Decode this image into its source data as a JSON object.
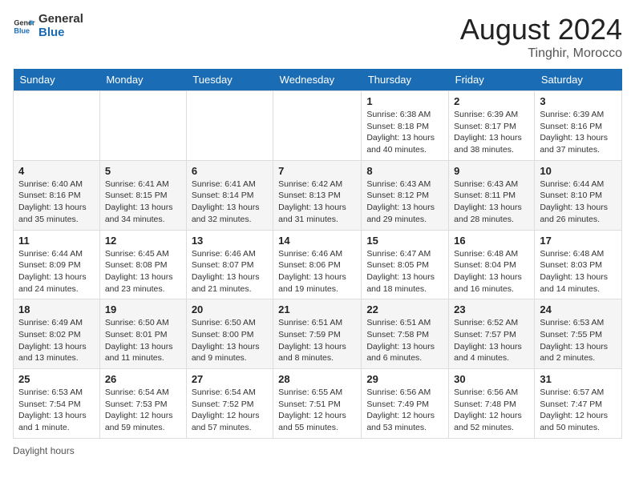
{
  "header": {
    "logo_general": "General",
    "logo_blue": "Blue",
    "month_year": "August 2024",
    "location": "Tinghir, Morocco"
  },
  "days_of_week": [
    "Sunday",
    "Monday",
    "Tuesday",
    "Wednesday",
    "Thursday",
    "Friday",
    "Saturday"
  ],
  "weeks": [
    [
      {
        "day": "",
        "info": ""
      },
      {
        "day": "",
        "info": ""
      },
      {
        "day": "",
        "info": ""
      },
      {
        "day": "",
        "info": ""
      },
      {
        "day": "1",
        "info": "Sunrise: 6:38 AM\nSunset: 8:18 PM\nDaylight: 13 hours and 40 minutes."
      },
      {
        "day": "2",
        "info": "Sunrise: 6:39 AM\nSunset: 8:17 PM\nDaylight: 13 hours and 38 minutes."
      },
      {
        "day": "3",
        "info": "Sunrise: 6:39 AM\nSunset: 8:16 PM\nDaylight: 13 hours and 37 minutes."
      }
    ],
    [
      {
        "day": "4",
        "info": "Sunrise: 6:40 AM\nSunset: 8:16 PM\nDaylight: 13 hours and 35 minutes."
      },
      {
        "day": "5",
        "info": "Sunrise: 6:41 AM\nSunset: 8:15 PM\nDaylight: 13 hours and 34 minutes."
      },
      {
        "day": "6",
        "info": "Sunrise: 6:41 AM\nSunset: 8:14 PM\nDaylight: 13 hours and 32 minutes."
      },
      {
        "day": "7",
        "info": "Sunrise: 6:42 AM\nSunset: 8:13 PM\nDaylight: 13 hours and 31 minutes."
      },
      {
        "day": "8",
        "info": "Sunrise: 6:43 AM\nSunset: 8:12 PM\nDaylight: 13 hours and 29 minutes."
      },
      {
        "day": "9",
        "info": "Sunrise: 6:43 AM\nSunset: 8:11 PM\nDaylight: 13 hours and 28 minutes."
      },
      {
        "day": "10",
        "info": "Sunrise: 6:44 AM\nSunset: 8:10 PM\nDaylight: 13 hours and 26 minutes."
      }
    ],
    [
      {
        "day": "11",
        "info": "Sunrise: 6:44 AM\nSunset: 8:09 PM\nDaylight: 13 hours and 24 minutes."
      },
      {
        "day": "12",
        "info": "Sunrise: 6:45 AM\nSunset: 8:08 PM\nDaylight: 13 hours and 23 minutes."
      },
      {
        "day": "13",
        "info": "Sunrise: 6:46 AM\nSunset: 8:07 PM\nDaylight: 13 hours and 21 minutes."
      },
      {
        "day": "14",
        "info": "Sunrise: 6:46 AM\nSunset: 8:06 PM\nDaylight: 13 hours and 19 minutes."
      },
      {
        "day": "15",
        "info": "Sunrise: 6:47 AM\nSunset: 8:05 PM\nDaylight: 13 hours and 18 minutes."
      },
      {
        "day": "16",
        "info": "Sunrise: 6:48 AM\nSunset: 8:04 PM\nDaylight: 13 hours and 16 minutes."
      },
      {
        "day": "17",
        "info": "Sunrise: 6:48 AM\nSunset: 8:03 PM\nDaylight: 13 hours and 14 minutes."
      }
    ],
    [
      {
        "day": "18",
        "info": "Sunrise: 6:49 AM\nSunset: 8:02 PM\nDaylight: 13 hours and 13 minutes."
      },
      {
        "day": "19",
        "info": "Sunrise: 6:50 AM\nSunset: 8:01 PM\nDaylight: 13 hours and 11 minutes."
      },
      {
        "day": "20",
        "info": "Sunrise: 6:50 AM\nSunset: 8:00 PM\nDaylight: 13 hours and 9 minutes."
      },
      {
        "day": "21",
        "info": "Sunrise: 6:51 AM\nSunset: 7:59 PM\nDaylight: 13 hours and 8 minutes."
      },
      {
        "day": "22",
        "info": "Sunrise: 6:51 AM\nSunset: 7:58 PM\nDaylight: 13 hours and 6 minutes."
      },
      {
        "day": "23",
        "info": "Sunrise: 6:52 AM\nSunset: 7:57 PM\nDaylight: 13 hours and 4 minutes."
      },
      {
        "day": "24",
        "info": "Sunrise: 6:53 AM\nSunset: 7:55 PM\nDaylight: 13 hours and 2 minutes."
      }
    ],
    [
      {
        "day": "25",
        "info": "Sunrise: 6:53 AM\nSunset: 7:54 PM\nDaylight: 13 hours and 1 minute."
      },
      {
        "day": "26",
        "info": "Sunrise: 6:54 AM\nSunset: 7:53 PM\nDaylight: 12 hours and 59 minutes."
      },
      {
        "day": "27",
        "info": "Sunrise: 6:54 AM\nSunset: 7:52 PM\nDaylight: 12 hours and 57 minutes."
      },
      {
        "day": "28",
        "info": "Sunrise: 6:55 AM\nSunset: 7:51 PM\nDaylight: 12 hours and 55 minutes."
      },
      {
        "day": "29",
        "info": "Sunrise: 6:56 AM\nSunset: 7:49 PM\nDaylight: 12 hours and 53 minutes."
      },
      {
        "day": "30",
        "info": "Sunrise: 6:56 AM\nSunset: 7:48 PM\nDaylight: 12 hours and 52 minutes."
      },
      {
        "day": "31",
        "info": "Sunrise: 6:57 AM\nSunset: 7:47 PM\nDaylight: 12 hours and 50 minutes."
      }
    ]
  ],
  "footer": {
    "note": "Daylight hours"
  }
}
